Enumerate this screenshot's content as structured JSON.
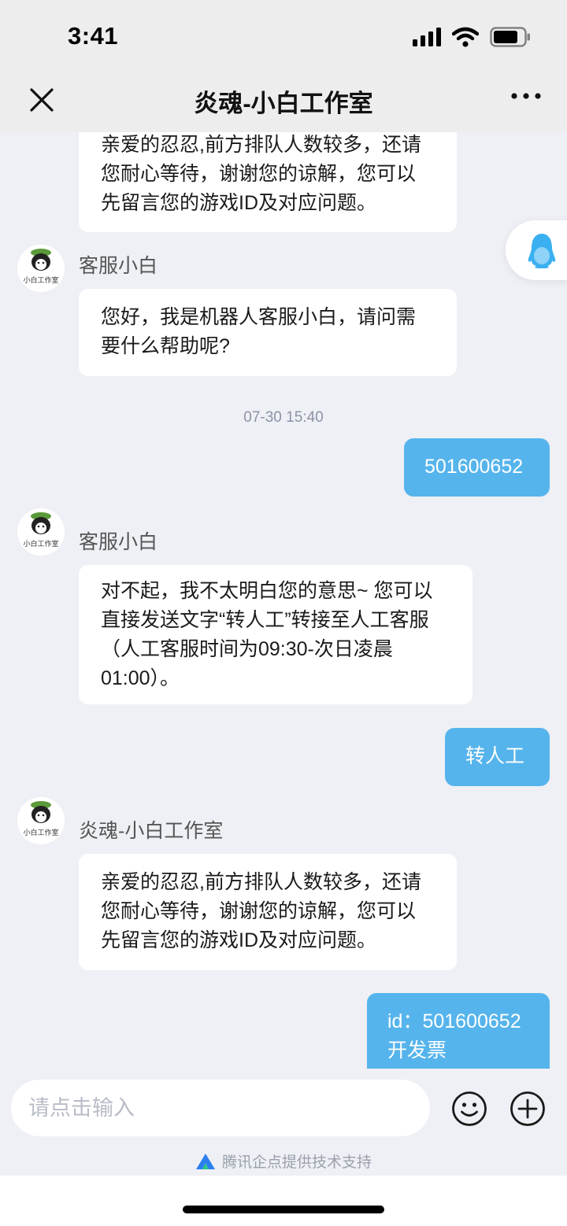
{
  "status_bar": {
    "time": "3:41"
  },
  "header": {
    "title": "炎魂-小白工作室"
  },
  "messages": [
    {
      "type": "in",
      "text": [
        "亲爱的忍忍,前方排队人数较多，还请",
        "您耐心等待，谢谢您的谅解，您可以",
        "先留言您的游戏ID及对应问题。"
      ]
    },
    {
      "type": "in",
      "sender": "客服小白",
      "avatar_text": "小白工作室",
      "text": [
        "您好，我是机器人客服小白，请问需",
        "要什么帮助呢?"
      ]
    },
    {
      "type": "time",
      "text": "07-30 15:40"
    },
    {
      "type": "out",
      "text": [
        "501600652"
      ]
    },
    {
      "type": "in",
      "sender": "客服小白",
      "avatar_text": "小白工作室",
      "text": [
        "对不起，我不太明白您的意思~ 您可以",
        "直接发送文字“转人工”转接至人工客服",
        "（人工客服时间为09:30-次日凌晨",
        "01:00）。"
      ]
    },
    {
      "type": "out",
      "text": [
        "转人工"
      ]
    },
    {
      "type": "in",
      "sender": "炎魂-小白工作室",
      "avatar_text": "小白工作室",
      "text": [
        "亲爱的忍忍,前方排队人数较多，还请",
        "您耐心等待，谢谢您的谅解，您可以",
        "先留言您的游戏ID及对应问题。"
      ]
    },
    {
      "type": "out",
      "text": [
        "id：501600652",
        "开发票"
      ]
    }
  ],
  "input": {
    "placeholder": "请点击输入"
  },
  "footer": {
    "powered_by": "腾讯企点提供技术支持"
  },
  "colors": {
    "accent": "#56b4ec",
    "background": "#eef0f5",
    "header": "#ededed",
    "bubble_in": "#ffffff"
  },
  "icons": [
    "close-icon",
    "more-icon",
    "qq-penguin-icon",
    "emoji-icon",
    "plus-icon",
    "qidian-logo-icon",
    "signal-icon",
    "wifi-icon",
    "battery-icon"
  ]
}
